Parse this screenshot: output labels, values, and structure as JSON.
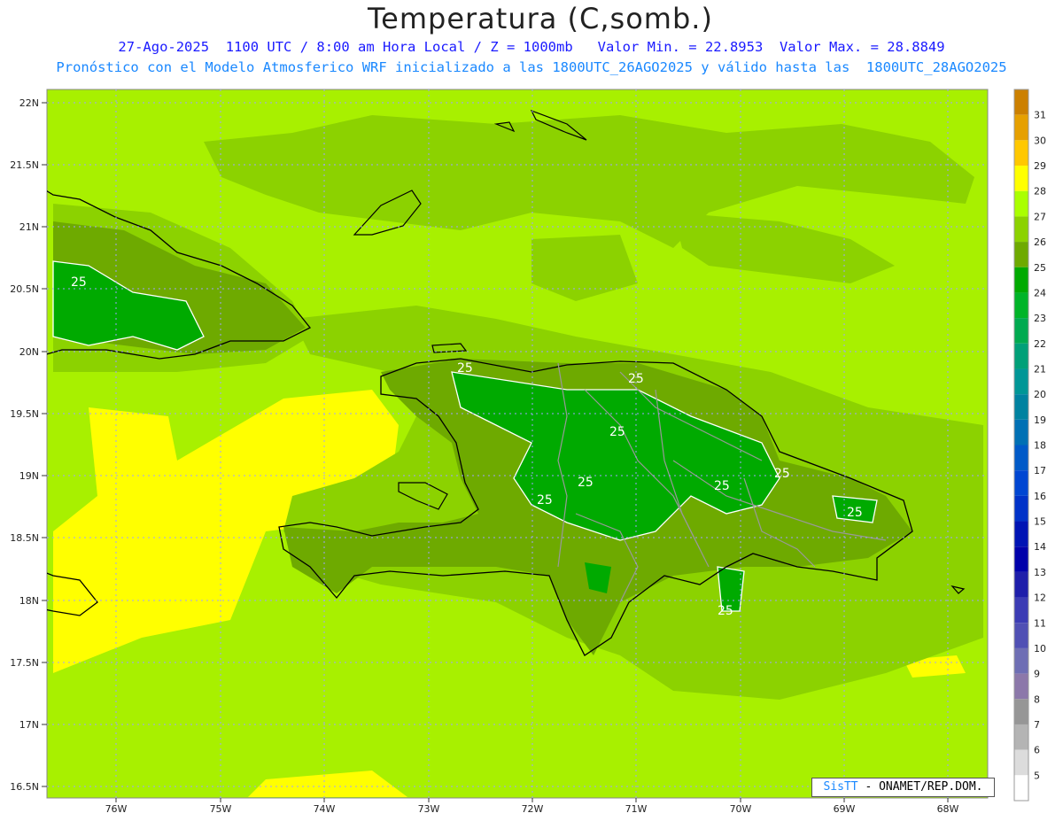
{
  "header": {
    "title": "Temperatura (C,somb.)",
    "line1": "27-Ago-2025  1100 UTC / 8:00 am Hora Local / Z = 1000mb   Valor Min. = 22.8953  Valor Max. = 28.8849",
    "line2": "Pronóstico con el Modelo Atmosferico WRF inicializado a las 1800UTC_26AGO2025 y válido hasta las  1800UTC_28AGO2025"
  },
  "map": {
    "lat_labels": [
      "22N",
      "21.5N",
      "21N",
      "20.5N",
      "20N",
      "19.5N",
      "19N",
      "18.5N",
      "18N",
      "17.5N",
      "17N",
      "16.5N"
    ],
    "lon_labels": [
      "76W",
      "75W",
      "74W",
      "73W",
      "72W",
      "71W",
      "70W",
      "69W",
      "68W"
    ],
    "contour_label": "25",
    "background_color": "#a8f000"
  },
  "colorbar": {
    "levels": [
      "31",
      "30",
      "29",
      "28",
      "27",
      "26",
      "25",
      "24",
      "23",
      "22",
      "21",
      "20",
      "19",
      "18",
      "17",
      "16",
      "15",
      "14",
      "13",
      "12",
      "11",
      "10",
      "9",
      "8",
      "7",
      "6",
      "5"
    ],
    "colors": [
      "#cc8000",
      "#e6a000",
      "#ffc800",
      "#ffff00",
      "#aaff00",
      "#8cd200",
      "#6eaa00",
      "#00aa00",
      "#00b428",
      "#00aa50",
      "#00a078",
      "#009696",
      "#0082a0",
      "#0070b4",
      "#005ac8",
      "#0046d2",
      "#0032c8",
      "#0014b4",
      "#0000aa",
      "#1e1eaa",
      "#3c3cb4",
      "#5050b4",
      "#6e6eb4",
      "#8c78aa",
      "#969696",
      "#b4b4b4",
      "#dcdcdc",
      "#ffffff"
    ]
  },
  "credit": {
    "brand": "SisTT",
    "text": " - ONAMET/REP.DOM."
  }
}
